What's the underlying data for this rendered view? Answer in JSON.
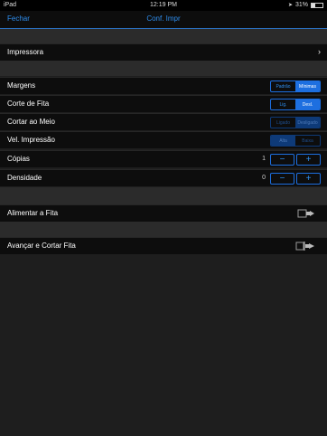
{
  "status_bar": {
    "device": "iPad",
    "time": "12:19 PM",
    "battery_text": "31%",
    "battery_level": 0.31
  },
  "nav": {
    "close_label": "Fechar",
    "title": "Conf. Impr"
  },
  "printer": {
    "label": "Impressora"
  },
  "margins": {
    "label": "Margens",
    "options": [
      "Padrão",
      "Mínimas"
    ],
    "selected": 1
  },
  "cut_tape": {
    "label": "Corte de Fita",
    "options": [
      "Lig.",
      "Desl."
    ],
    "selected": 1
  },
  "half_cut": {
    "label": "Cortar ao Meio",
    "options": [
      "Ligado",
      "Desligado"
    ],
    "selected": 1
  },
  "print_speed": {
    "label": "Vel. Impressão",
    "options": [
      "Alta",
      "Baixa"
    ],
    "selected": 0
  },
  "copies": {
    "label": "Cópias",
    "value": "1",
    "minus": "−",
    "plus": "+"
  },
  "density": {
    "label": "Densidade",
    "value": "0",
    "minus": "−",
    "plus": "+"
  },
  "feed_tape": {
    "label": "Alimentar a Fita",
    "icon": "feed-tape-icon"
  },
  "feed_cut_tape": {
    "label": "Avançar e Cortar Fita",
    "icon": "feed-cut-icon"
  },
  "colors": {
    "accent": "#1d6fe0",
    "background": "#1e1e1e",
    "row": "#0d0d0d"
  }
}
